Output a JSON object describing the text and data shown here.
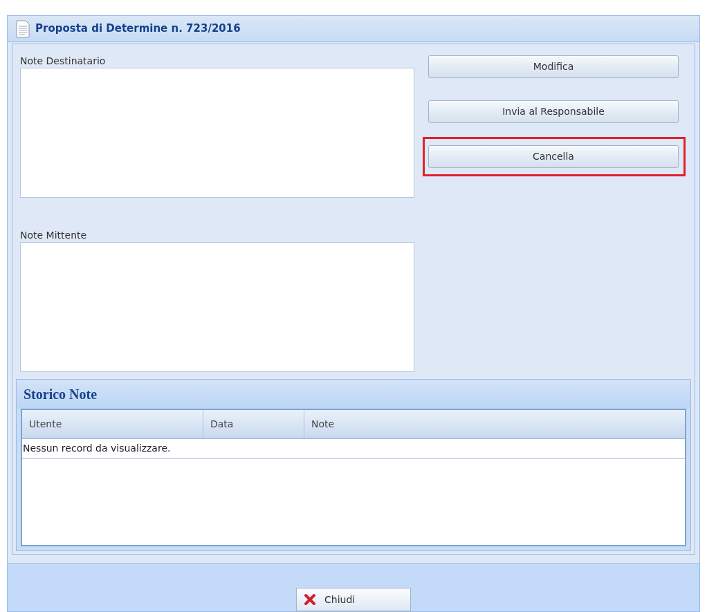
{
  "window": {
    "title": "Proposta di Determine n. 723/2016"
  },
  "fields": [
    {
      "label": "Note Destinatario"
    },
    {
      "label": "Note Mittente"
    }
  ],
  "buttons": [
    {
      "label": "Modifica",
      "highlighted": false
    },
    {
      "label": "Invia al Responsabile",
      "highlighted": false
    },
    {
      "label": "Cancella",
      "highlighted": true
    }
  ],
  "history": {
    "title": "Storico Note",
    "columns": [
      "Utente",
      "Data",
      "Note"
    ],
    "empty_message": "Nessun record da visualizzare."
  },
  "footer": {
    "close_button": "Chiudi"
  }
}
